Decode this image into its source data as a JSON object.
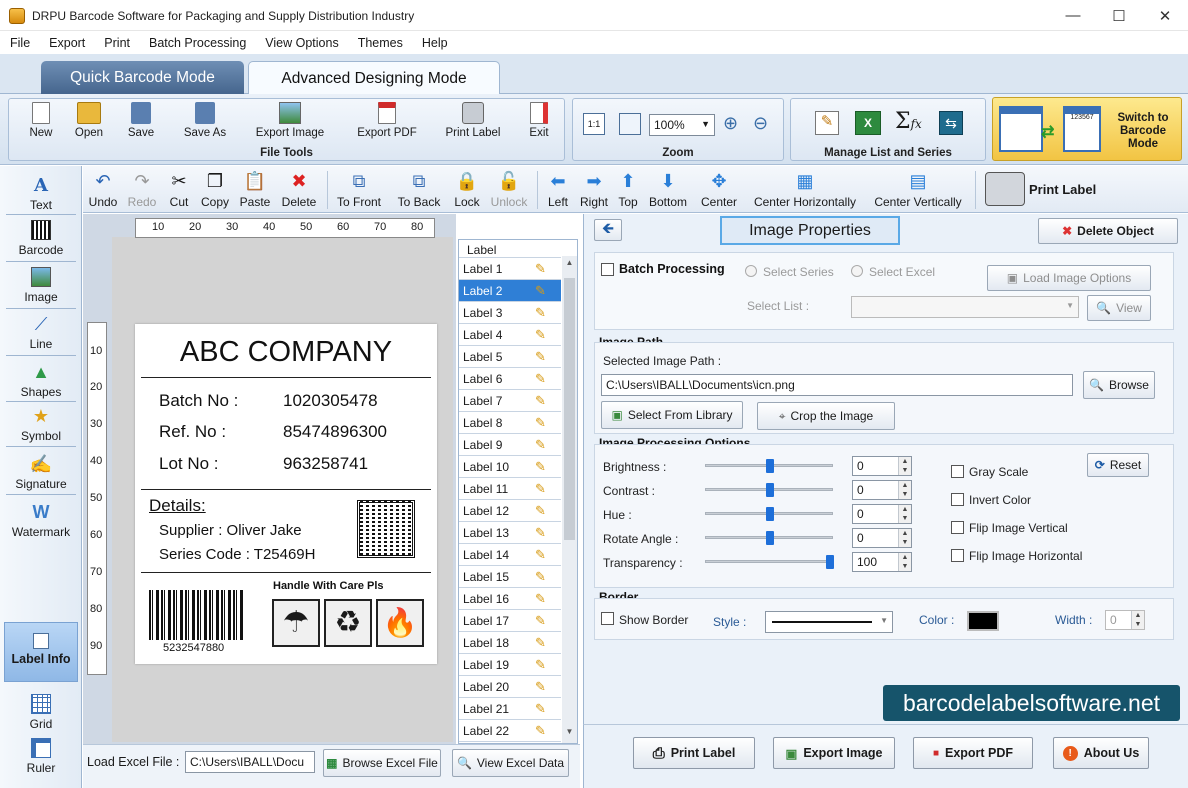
{
  "window": {
    "title": "DRPU Barcode Software for Packaging and Supply Distribution Industry"
  },
  "menu": [
    "File",
    "Export",
    "Print",
    "Batch Processing",
    "View Options",
    "Themes",
    "Help"
  ],
  "modes": {
    "quick": "Quick Barcode Mode",
    "advanced": "Advanced Designing Mode"
  },
  "ribbon": {
    "file_tools": {
      "title": "File Tools",
      "new": "New",
      "open": "Open",
      "save": "Save",
      "save_as": "Save As",
      "export_image": "Export Image",
      "export_pdf": "Export PDF",
      "print_label": "Print Label",
      "exit": "Exit"
    },
    "zoom": {
      "title": "Zoom",
      "value": "100%"
    },
    "manage": {
      "title": "Manage List and Series"
    },
    "switch": {
      "label": "Switch to Barcode Mode",
      "sample_number": "123567"
    }
  },
  "toolbox": {
    "text": "Text",
    "barcode": "Barcode",
    "image": "Image",
    "line": "Line",
    "shapes": "Shapes",
    "symbol": "Symbol",
    "signature": "Signature",
    "watermark": "Watermark",
    "label_info": "Label Info",
    "grid": "Grid",
    "ruler": "Ruler"
  },
  "edit_toolbar": {
    "undo": "Undo",
    "redo": "Redo",
    "cut": "Cut",
    "copy": "Copy",
    "paste": "Paste",
    "delete": "Delete",
    "to_front": "To Front",
    "to_back": "To Back",
    "lock": "Lock",
    "unlock": "Unlock",
    "left": "Left",
    "right": "Right",
    "top": "Top",
    "bottom": "Bottom",
    "center": "Center",
    "center_h": "Center Horizontally",
    "center_v": "Center Vertically",
    "print_label": "Print Label"
  },
  "ruler": {
    "h": [
      "10",
      "20",
      "30",
      "40",
      "50",
      "60",
      "70",
      "80"
    ],
    "v": [
      "10",
      "20",
      "30",
      "40",
      "50",
      "60",
      "70",
      "80",
      "90"
    ]
  },
  "label_design": {
    "company": "ABC COMPANY",
    "batch_key": "Batch No :",
    "batch_val": "1020305478",
    "ref_key": "Ref. No :",
    "ref_val": "85474896300",
    "lot_key": "Lot No :",
    "lot_val": "963258741",
    "details": "Details:",
    "supplier": "Supplier :  Oliver Jake",
    "series": "Series Code :  T25469H",
    "handle": "Handle With Care Pls",
    "barcode_number": "5232547880"
  },
  "label_list": {
    "header": "Label",
    "items": [
      "Label 1",
      "Label 2",
      "Label 3",
      "Label 4",
      "Label 5",
      "Label 6",
      "Label 7",
      "Label 8",
      "Label 9",
      "Label 10",
      "Label 11",
      "Label 12",
      "Label 13",
      "Label 14",
      "Label 15",
      "Label 16",
      "Label 17",
      "Label 18",
      "Label 19",
      "Label 20",
      "Label 21",
      "Label 22"
    ],
    "selected": "Label 2"
  },
  "excel": {
    "label": "Load Excel File :",
    "path": "C:\\Users\\IBALL\\Docu",
    "browse": "Browse Excel File",
    "view": "View Excel Data"
  },
  "props": {
    "title": "Image Properties",
    "delete": "Delete Object",
    "batch": "Batch Processing",
    "select_series": "Select Series",
    "select_excel": "Select Excel",
    "load_options": "Load Image Options",
    "select_list": "Select List :",
    "view": "View",
    "image_path_title": "Image Path",
    "selected_path_label": "Selected Image Path :",
    "path": "C:\\Users\\IBALL\\Documents\\icn.png",
    "browse": "Browse",
    "library": "Select From Library",
    "crop": "Crop the Image",
    "processing_title": "Image Processing Options",
    "brightness": "Brightness :",
    "brightness_val": "0",
    "contrast": "Contrast :",
    "contrast_val": "0",
    "hue": "Hue :",
    "hue_val": "0",
    "rotate": "Rotate Angle :",
    "rotate_val": "0",
    "transparency": "Transparency :",
    "transparency_val": "100",
    "reset": "Reset",
    "gray": "Gray Scale",
    "invert": "Invert Color",
    "flip_v": "Flip Image Vertical",
    "flip_h": "Flip Image Horizontal",
    "border_title": "Border",
    "show_border": "Show Border",
    "style": "Style :",
    "color": "Color :",
    "width": "Width :",
    "width_val": "0"
  },
  "bottom_buttons": {
    "print": "Print Label",
    "export_image": "Export Image",
    "export_pdf": "Export PDF",
    "about": "About Us"
  },
  "watermark": "barcodelabelsoftware.net",
  "colors": {
    "accent": "#2f7fd6",
    "mode_tab": "#4f6f97",
    "watermark_bg": "#16546b"
  }
}
